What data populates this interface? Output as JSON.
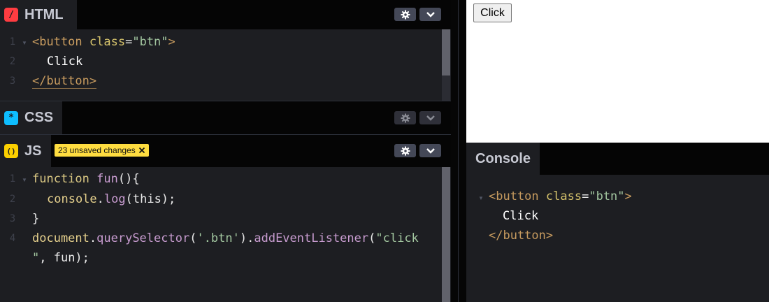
{
  "html_panel": {
    "title": "HTML",
    "icon_glyph": "/",
    "lines": [
      {
        "num": "1",
        "open": "<button",
        "attr": "class",
        "eq": "=",
        "str": "\"btn\"",
        "close": ">"
      },
      {
        "num": "2",
        "text": "Click"
      },
      {
        "num": "3",
        "closetag": "</button>"
      }
    ]
  },
  "css_panel": {
    "title": "CSS",
    "icon_glyph": "*"
  },
  "js_panel": {
    "title": "JS",
    "icon_glyph": "()",
    "badge": "23 unsaved changes",
    "lines": [
      {
        "num": "1"
      },
      {
        "num": "2"
      },
      {
        "num": "3"
      },
      {
        "num": "4"
      }
    ],
    "code": {
      "l1_kw": "function",
      "l1_fn": "fun",
      "l1_rest": "(){",
      "l2_obj": "console",
      "l2_dot": ".",
      "l2_fn": "log",
      "l2_rest": "(this);",
      "l3": "}",
      "l4_obj": "document",
      "l4_dot1": ".",
      "l4_fn1": "querySelector",
      "l4_p1": "(",
      "l4_s1": "'.btn'",
      "l4_p2": ").",
      "l4_fn2": "addEventListener",
      "l4_p3": "(",
      "l4_s2": "\"click",
      "l5_s": "\"",
      "l5_rest": ", fun);"
    }
  },
  "preview": {
    "button_label": "Click"
  },
  "console": {
    "title": "Console",
    "open": "<button",
    "attr": "class",
    "eq": "=",
    "str": "\"btn\"",
    "close": ">",
    "text": "Click",
    "closetag": "</button>"
  },
  "colors": {
    "html_icon": "#ff3c41",
    "css_icon": "#0ebeff",
    "js_icon": "#fcd000",
    "badge": "#ffdd40"
  }
}
